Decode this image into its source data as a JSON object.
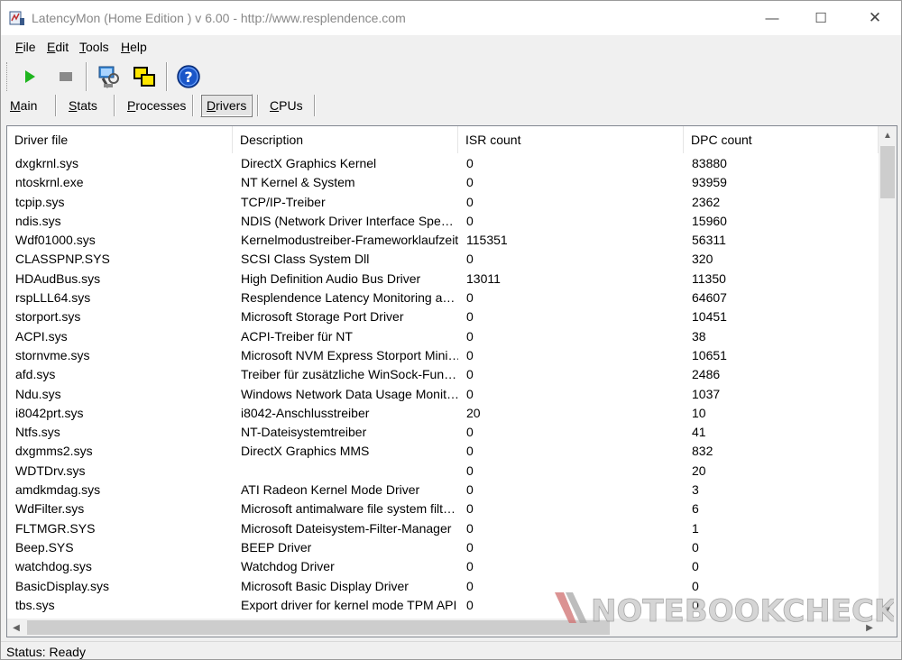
{
  "window": {
    "title": "LatencyMon  (Home Edition )  v 6.00 - http://www.resplendence.com",
    "controls": {
      "minimize": "—",
      "maximize": "☐",
      "close": "✕"
    }
  },
  "menu": [
    {
      "underline": "F",
      "rest": "ile"
    },
    {
      "underline": "E",
      "rest": "dit"
    },
    {
      "underline": "T",
      "rest": "ools"
    },
    {
      "underline": "H",
      "rest": "elp"
    }
  ],
  "toolbar": {
    "icons": [
      "play-icon",
      "stop-icon",
      "analyze-icon",
      "windows-icon",
      "help-icon"
    ],
    "colors": {
      "play": "#1fb51f",
      "stop": "#8a8a8a",
      "help": "#1a56c8"
    }
  },
  "tabs": [
    {
      "underline": "M",
      "rest": "ain",
      "active": false
    },
    {
      "underline": "S",
      "rest": "tats",
      "active": false
    },
    {
      "underline": "P",
      "rest": "rocesses",
      "active": false
    },
    {
      "underline": "D",
      "rest": "rivers",
      "active": true
    },
    {
      "underline": "C",
      "rest": "PUs",
      "active": false
    }
  ],
  "table": {
    "columns": [
      "Driver file",
      "Description",
      "ISR count",
      "DPC count"
    ],
    "rows": [
      [
        "dxgkrnl.sys",
        "DirectX Graphics Kernel",
        "0",
        "83880"
      ],
      [
        "ntoskrnl.exe",
        "NT Kernel & System",
        "0",
        "93959"
      ],
      [
        "tcpip.sys",
        "TCP/IP-Treiber",
        "0",
        "2362"
      ],
      [
        "ndis.sys",
        "NDIS (Network Driver Interface Spe…",
        "0",
        "15960"
      ],
      [
        "Wdf01000.sys",
        "Kernelmodustreiber-Frameworklaufzeit",
        "115351",
        "56311"
      ],
      [
        "CLASSPNP.SYS",
        "SCSI Class System Dll",
        "0",
        "320"
      ],
      [
        "HDAudBus.sys",
        "High Definition Audio Bus Driver",
        "13011",
        "11350"
      ],
      [
        "rspLLL64.sys",
        "Resplendence Latency Monitoring a…",
        "0",
        "64607"
      ],
      [
        "storport.sys",
        "Microsoft Storage Port Driver",
        "0",
        "10451"
      ],
      [
        "ACPI.sys",
        "ACPI-Treiber für NT",
        "0",
        "38"
      ],
      [
        "stornvme.sys",
        "Microsoft NVM Express Storport Mini…",
        "0",
        "10651"
      ],
      [
        "afd.sys",
        "Treiber für zusätzliche WinSock-Fun…",
        "0",
        "2486"
      ],
      [
        "Ndu.sys",
        "Windows Network Data Usage Monit…",
        "0",
        "1037"
      ],
      [
        "i8042prt.sys",
        "i8042-Anschlusstreiber",
        "20",
        "10"
      ],
      [
        "Ntfs.sys",
        "NT-Dateisystemtreiber",
        "0",
        "41"
      ],
      [
        "dxgmms2.sys",
        "DirectX Graphics MMS",
        "0",
        "832"
      ],
      [
        "WDTDrv.sys",
        "",
        "0",
        "20"
      ],
      [
        "amdkmdag.sys",
        "ATI Radeon Kernel Mode Driver",
        "0",
        "3"
      ],
      [
        "WdFilter.sys",
        "Microsoft antimalware file system filt…",
        "0",
        "6"
      ],
      [
        "FLTMGR.SYS",
        "Microsoft Dateisystem-Filter-Manager",
        "0",
        "1"
      ],
      [
        "Beep.SYS",
        "BEEP Driver",
        "0",
        "0"
      ],
      [
        "watchdog.sys",
        "Watchdog Driver",
        "0",
        "0"
      ],
      [
        "BasicDisplay.sys",
        "Microsoft Basic Display Driver",
        "0",
        "0"
      ],
      [
        "tbs.sys",
        "Export driver for kernel mode TPM API",
        "0",
        "0"
      ]
    ]
  },
  "status": {
    "text": "Status: Ready"
  },
  "watermark": {
    "text": "NOTEBOOKCHECK"
  }
}
